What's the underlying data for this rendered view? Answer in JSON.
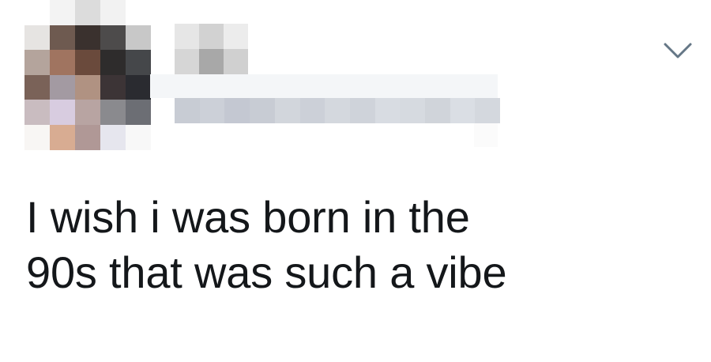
{
  "tweet": {
    "text": "I wish i was born in the\n90s that was such a vibe"
  },
  "avatar": {
    "state": "pixelated",
    "pixels": [
      [
        "#ffffff",
        "#f3f3f3",
        "#dcdcdc",
        "#f2f2f2",
        "#ffffff"
      ],
      [
        "#e6e4e2",
        "#6e5a50",
        "#3a312e",
        "#4d4b4b",
        "#c8c8c8"
      ],
      [
        "#b4a49c",
        "#a07460",
        "#6a4a3c",
        "#2e2c2c",
        "#45474a"
      ],
      [
        "#7a6258",
        "#a39aa2",
        "#b09282",
        "#3c3436",
        "#2a2b30"
      ],
      [
        "#c9bcc0",
        "#d8cce0",
        "#b8a4a2",
        "#8a8a8e",
        "#6c6e74"
      ],
      [
        "#f8f6f4",
        "#d8ac92",
        "#b09896",
        "#e6e6ee",
        "#f8f8f8"
      ]
    ]
  },
  "identity": {
    "state": "pixelated",
    "name_blocks": [
      "#e6e6e6",
      "#d2d2d2",
      "#ececec"
    ],
    "name_row2": [
      "#d6d6d6",
      "#a8a8a8",
      "#d0d0d0"
    ],
    "faint_row": "#f4f6f8",
    "handle_row": [
      "#c8ccd4",
      "#ccd0d8",
      "#c4c8d2",
      "#c8ccd4",
      "#d2d6dc",
      "#ccd0d8",
      "#d4d8de",
      "#cfd3da",
      "#d8dce2",
      "#d6dae0",
      "#d0d4da",
      "#dadee4",
      "#d4d8de"
    ]
  },
  "menu": {
    "icon": "chevron-down-icon",
    "color": "#657786"
  }
}
